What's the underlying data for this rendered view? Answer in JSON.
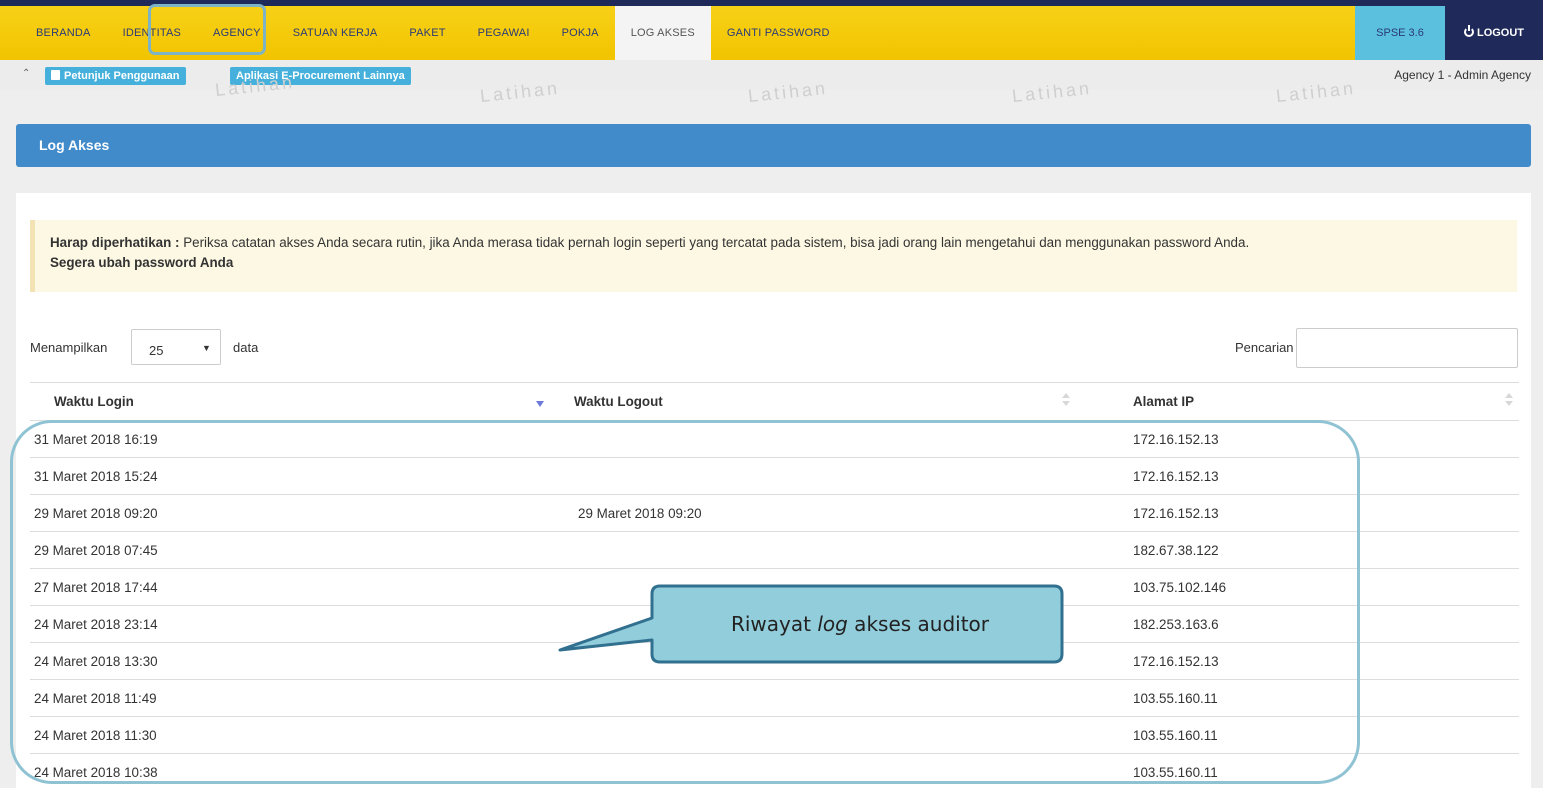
{
  "navbar": {
    "items": [
      {
        "label": "BERANDA",
        "active": false
      },
      {
        "label": "IDENTITAS",
        "active": false
      },
      {
        "label": "AGENCY",
        "active": false
      },
      {
        "label": "SATUAN KERJA",
        "active": false
      },
      {
        "label": "PAKET",
        "active": false
      },
      {
        "label": "PEGAWAI",
        "active": false
      },
      {
        "label": "POKJA",
        "active": false
      },
      {
        "label": "LOG AKSES",
        "active": true
      },
      {
        "label": "GANTI PASSWORD",
        "active": false
      }
    ],
    "version": "SPSE 3.6",
    "logout": "LOGOUT",
    "colors": {
      "bar": "#f7d117",
      "top_border": "#1f2a5a",
      "version_bg": "#5bc0de",
      "logout_bg": "#1f2a5a"
    }
  },
  "subbar": {
    "collapse_icon": "chevron-double-up-icon",
    "petunjuk": "Petunjuk Penggunaan",
    "aplikasi": "Aplikasi E-Procurement Lainnya",
    "user_info": "Agency 1 - Admin Agency",
    "watermark": "Latihan"
  },
  "panel": {
    "title": "Log Akses",
    "color": "#428bca"
  },
  "alert": {
    "label": "Harap diperhatikan :",
    "text": " Periksa catatan akses Anda secara rutin, jika Anda merasa tidak pernah login seperti yang tercatat pada sistem, bisa jadi orang lain mengetahui dan menggunakan password Anda.",
    "action": "Segera ubah password Anda"
  },
  "table_controls": {
    "show_label": "Menampilkan",
    "page_length": "25",
    "show_suffix": "data",
    "search_label": "Pencarian",
    "search_value": ""
  },
  "table": {
    "headers": [
      "Waktu Login",
      "Waktu Logout",
      "Alamat IP"
    ],
    "rows": [
      [
        "31 Maret 2018 16:19",
        "",
        "172.16.152.13"
      ],
      [
        "31 Maret 2018 15:24",
        "",
        "172.16.152.13"
      ],
      [
        "29 Maret 2018 09:20",
        "29 Maret 2018 09:20",
        "172.16.152.13"
      ],
      [
        "29 Maret 2018 07:45",
        "",
        "182.67.38.122"
      ],
      [
        "27 Maret 2018 17:44",
        "",
        "103.75.102.146"
      ],
      [
        "24 Maret 2018 23:14",
        "",
        "182.253.163.6"
      ],
      [
        "24 Maret 2018 13:30",
        "",
        "172.16.152.13"
      ],
      [
        "24 Maret 2018 11:49",
        "",
        "103.55.160.11"
      ],
      [
        "24 Maret 2018 11:30",
        "",
        "103.55.160.11"
      ],
      [
        "24 Maret 2018 10:38",
        "",
        "103.55.160.11"
      ]
    ]
  },
  "annotation": {
    "pre": "Riwayat ",
    "em": "log",
    "post": " akses auditor",
    "color": "#92cddc"
  }
}
